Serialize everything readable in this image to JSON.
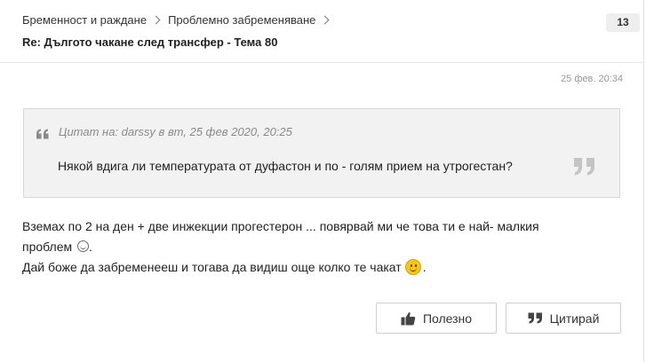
{
  "breadcrumb": {
    "items": [
      "Бременност и раждане",
      "Проблемно забременяване"
    ]
  },
  "thread": {
    "title": "Re: Дългото чакане след трансфер - Тема 80",
    "reply_count": "13"
  },
  "post": {
    "timestamp": "25 фев. 20:34",
    "quote": {
      "author_line": "Цитат на: darssy в вт, 25 фев 2020, 20:25",
      "text": "Някой вдига ли температурата от дуфастон и по - голям прием на утрогестан?"
    },
    "body": {
      "line1": "Вземах по 2 на ден + две инжекции прогестерон ... повярвай ми че това ти е най- малкия",
      "line2": "проблем",
      "line2_end": ".",
      "line3": "Дай боже да забременееш и тогава да видиш още колко те чакат",
      "line3_end": "."
    },
    "emojis": [
      "laughing-emoji",
      "smile-emoji"
    ]
  },
  "actions": {
    "like_label": "Полезно",
    "quote_label": "Цитирай"
  },
  "icons": {
    "quote_open": "quote-open-icon",
    "quote_close": "quote-close-icon",
    "like": "thumbs-up-icon",
    "quote_button": "quote-icon"
  },
  "colors": {
    "quote_background": "#f2f2f2",
    "quote_border": "#d8d8d8",
    "muted_text": "#8a8a8a",
    "button_border": "#cfcfcf"
  }
}
